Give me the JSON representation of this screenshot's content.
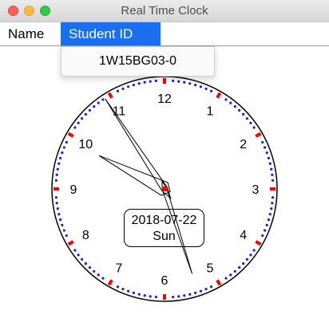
{
  "window": {
    "title": "Real Time Clock"
  },
  "menubar": {
    "items": [
      {
        "label": "Name"
      },
      {
        "label": "Student ID"
      }
    ]
  },
  "dropdown": {
    "items": [
      {
        "label": "1W15BG03-0"
      }
    ]
  },
  "clock": {
    "numbers": [
      "12",
      "1",
      "2",
      "3",
      "4",
      "5",
      "6",
      "7",
      "8",
      "9",
      "10",
      "11"
    ],
    "time": {
      "hour": 9,
      "minute": 54,
      "second": 27
    },
    "date": "2018-07-22",
    "weekday": "Sun",
    "colors": {
      "minute_dots": "#1a1aff",
      "hour_marks": "#ff0000",
      "outline": "#000000"
    }
  }
}
